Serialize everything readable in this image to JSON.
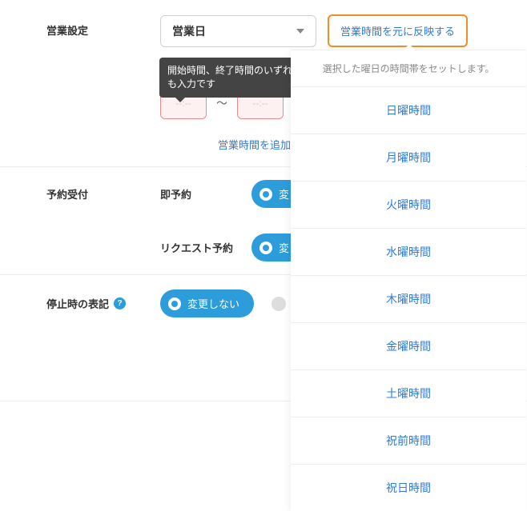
{
  "section1": {
    "label": "営業設定",
    "select_value": "営業日",
    "reflect_btn": "営業時間を元に反映する",
    "tooltip": "開始時間、終了時間のいずれも入力です",
    "time_start_placeholder": "--:--",
    "time_end_placeholder": "--:--",
    "range_separator": "〜",
    "add_time_btn": "営業時間を追加する"
  },
  "section2": {
    "label": "予約受付",
    "row1_label": "即予約",
    "row1_btn": "変",
    "row2_label": "リクエスト予約",
    "row2_btn": "変"
  },
  "section3": {
    "label": "停止時の表記",
    "btn_label": "変更しない"
  },
  "dropdown": {
    "header": "選択した曜日の時間帯をセットします。",
    "items": [
      "日曜時間",
      "月曜時間",
      "火曜時間",
      "水曜時間",
      "木曜時間",
      "金曜時間",
      "土曜時間",
      "祝前時間",
      "祝日時間"
    ]
  }
}
